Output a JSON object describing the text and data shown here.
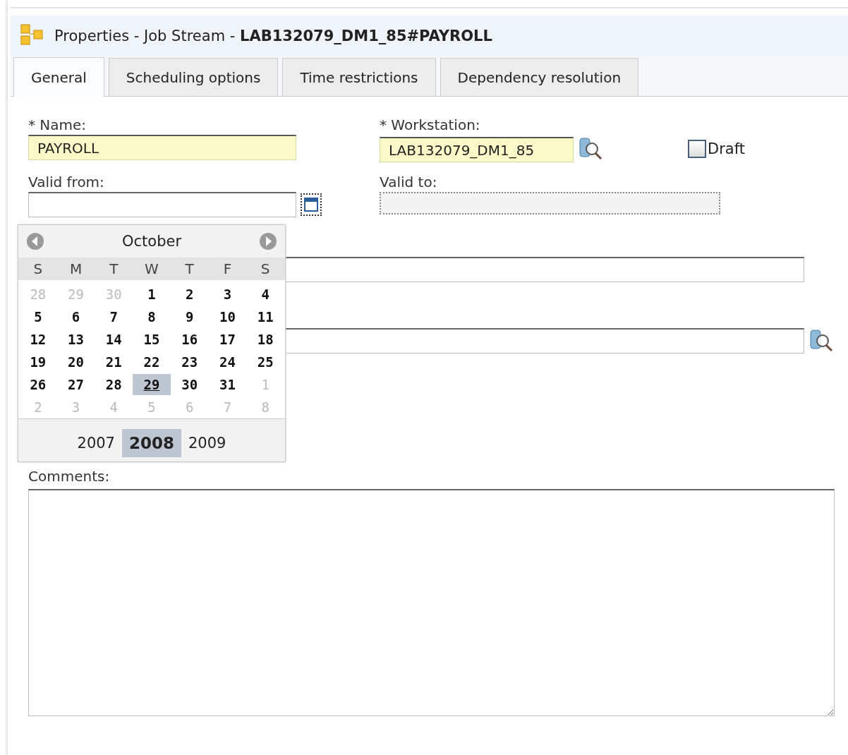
{
  "window": {
    "title": "Properties - Job Stream - **LAB132079_DM1_85#PAYROLL**"
  },
  "tabs": [
    {
      "label": "General",
      "selected": true
    },
    {
      "label": "Scheduling options",
      "selected": false
    },
    {
      "label": "Time restrictions",
      "selected": false
    },
    {
      "label": "Dependency resolution",
      "selected": false
    }
  ],
  "form": {
    "name": {
      "label": "* Name:",
      "value": "PAYROLL",
      "required": true
    },
    "workstation": {
      "label": "* Workstation:",
      "value": "LAB132079_DM1_85",
      "required": true
    },
    "draft": {
      "label": "Draft",
      "checked": false
    },
    "valid_from": {
      "label": "Valid from:"
    },
    "valid_to": {
      "label": "Valid to:",
      "disabled": true
    },
    "field_3": {
      "kind": "text"
    },
    "field_4": {
      "kind": "lookup"
    },
    "comments": {
      "label": "Comments:"
    }
  },
  "calendar": {
    "month": "October",
    "weekdays": [
      "S",
      "M",
      "T",
      "W",
      "T",
      "F",
      "S"
    ],
    "weeks": [
      [
        {
          "day": "28",
          "other_month": true,
          "selected": false
        },
        {
          "day": "29",
          "other_month": true,
          "selected": false
        },
        {
          "day": "30",
          "other_month": true,
          "selected": false
        },
        {
          "day": "1",
          "other_month": false,
          "selected": false
        },
        {
          "day": "2",
          "other_month": false,
          "selected": false
        },
        {
          "day": "3",
          "other_month": false,
          "selected": false
        },
        {
          "day": "4",
          "other_month": false,
          "selected": false
        }
      ],
      [
        {
          "day": "5",
          "other_month": false,
          "selected": false
        },
        {
          "day": "6",
          "other_month": false,
          "selected": false
        },
        {
          "day": "7",
          "other_month": false,
          "selected": false
        },
        {
          "day": "8",
          "other_month": false,
          "selected": false
        },
        {
          "day": "9",
          "other_month": false,
          "selected": false
        },
        {
          "day": "10",
          "other_month": false,
          "selected": false
        },
        {
          "day": "11",
          "other_month": false,
          "selected": false
        }
      ],
      [
        {
          "day": "12",
          "other_month": false,
          "selected": false
        },
        {
          "day": "13",
          "other_month": false,
          "selected": false
        },
        {
          "day": "14",
          "other_month": false,
          "selected": false
        },
        {
          "day": "15",
          "other_month": false,
          "selected": false
        },
        {
          "day": "16",
          "other_month": false,
          "selected": false
        },
        {
          "day": "17",
          "other_month": false,
          "selected": false
        },
        {
          "day": "18",
          "other_month": false,
          "selected": false
        }
      ],
      [
        {
          "day": "19",
          "other_month": false,
          "selected": false
        },
        {
          "day": "20",
          "other_month": false,
          "selected": false
        },
        {
          "day": "21",
          "other_month": false,
          "selected": false
        },
        {
          "day": "22",
          "other_month": false,
          "selected": false
        },
        {
          "day": "23",
          "other_month": false,
          "selected": false
        },
        {
          "day": "24",
          "other_month": false,
          "selected": false
        },
        {
          "day": "25",
          "other_month": false,
          "selected": false
        }
      ],
      [
        {
          "day": "26",
          "other_month": false,
          "selected": false
        },
        {
          "day": "27",
          "other_month": false,
          "selected": false
        },
        {
          "day": "28",
          "other_month": false,
          "selected": false
        },
        {
          "day": "29",
          "other_month": false,
          "selected": true
        },
        {
          "day": "30",
          "other_month": false,
          "selected": false
        },
        {
          "day": "31",
          "other_month": false,
          "selected": false
        },
        {
          "day": "1",
          "other_month": true,
          "selected": false
        }
      ],
      [
        {
          "day": "2",
          "other_month": true,
          "selected": false
        },
        {
          "day": "3",
          "other_month": true,
          "selected": false
        },
        {
          "day": "4",
          "other_month": true,
          "selected": false
        },
        {
          "day": "5",
          "other_month": true,
          "selected": false
        },
        {
          "day": "6",
          "other_month": true,
          "selected": false
        },
        {
          "day": "7",
          "other_month": true,
          "selected": false
        },
        {
          "day": "8",
          "other_month": true,
          "selected": false
        }
      ]
    ],
    "years": [
      {
        "label": "2007",
        "selected": false
      },
      {
        "label": "2008",
        "selected": true
      },
      {
        "label": "2009",
        "selected": false
      }
    ]
  }
}
